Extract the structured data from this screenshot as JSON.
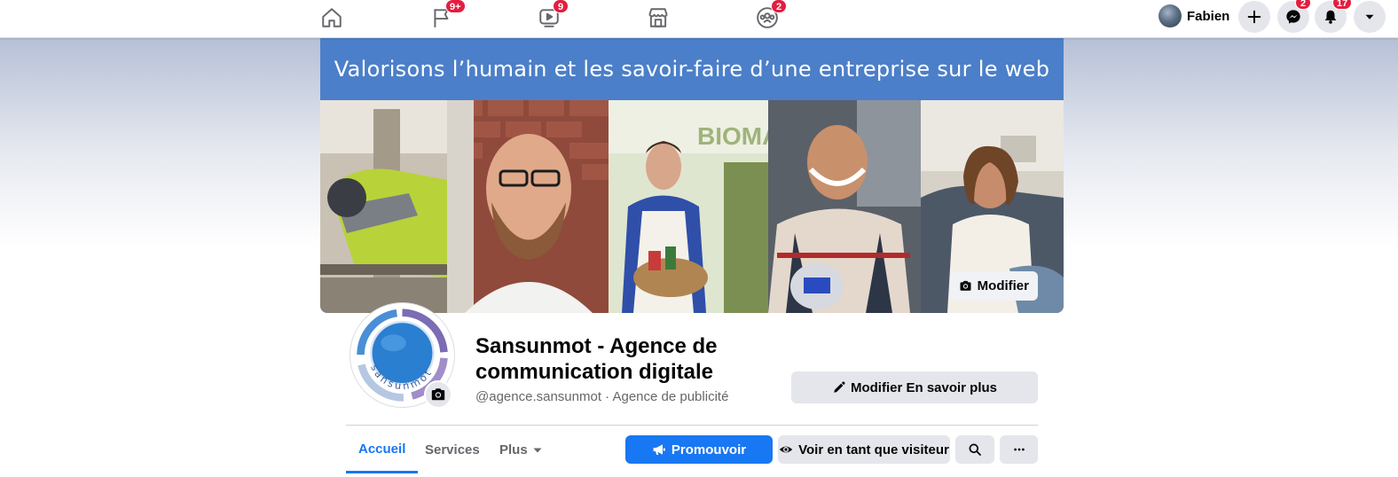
{
  "topnav": {
    "tabs": [
      {
        "icon": "home-icon"
      },
      {
        "icon": "flag-icon",
        "badge": "9+"
      },
      {
        "icon": "video-icon",
        "badge": "9"
      },
      {
        "icon": "marketplace-icon"
      },
      {
        "icon": "groups-icon",
        "badge": "2"
      }
    ],
    "profile_name": "Fabien",
    "create_icon": "plus-icon",
    "messenger_badge": "2",
    "notifications_badge": "17",
    "account_icon": "caret-down-icon"
  },
  "cover": {
    "banner_text": "Valorisons l’humain et les savoir-faire d’une entreprise sur le web",
    "edit_label": "Modifier"
  },
  "page": {
    "title": "Sansunmot - Agence de communication digitale",
    "subtitle": "@agence.sansunmot · Agence de publicité",
    "logo_text": "sansunmot",
    "edit_more_label": "Modifier En savoir plus"
  },
  "tabs": {
    "home": "Accueil",
    "services": "Services",
    "more": "Plus"
  },
  "actions": {
    "promote": "Promouvoir",
    "view_as_visitor": "Voir en tant que visiteur"
  },
  "colors": {
    "accent": "#1877f2",
    "badge": "#e41e3f",
    "banner": "#4c7fc9"
  }
}
